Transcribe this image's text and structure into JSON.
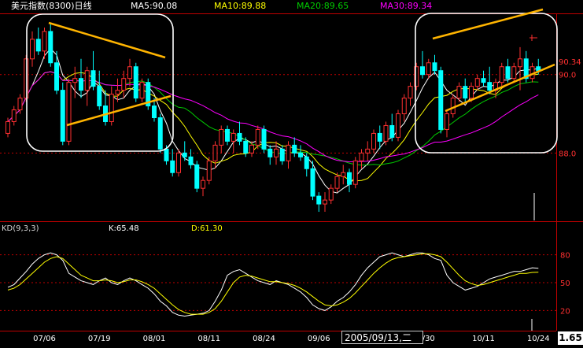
{
  "header": {
    "title": "美元指数(8300)日线",
    "ma5": "MA5:90.08",
    "ma10": "MA10:89.88",
    "ma20": "MA20:89.65",
    "ma30": "MA30:89.34"
  },
  "kd": {
    "label": "KD(9,3,3)",
    "k": "K:65.48",
    "d": "D:61.30"
  },
  "cursor": {
    "date_label": "2005/09/13,二",
    "price_label": "1.65"
  },
  "colors": {
    "up": "#ff3030",
    "down": "#00ffff",
    "ma5": "#ffffff",
    "ma10": "#ffff00",
    "ma20": "#00cc00",
    "ma30": "#ff00ff",
    "trend": "#ffb400",
    "grid": "#c00000"
  },
  "chart_data": [
    {
      "type": "candlestick",
      "title": "美元指数(8300)日线",
      "ylim": [
        86.3,
        91.5
      ],
      "y_ticks": [
        {
          "value": 90.34,
          "label": "90.34"
        },
        {
          "value": 90.0,
          "label": "90.0"
        },
        {
          "value": 88.0,
          "label": "88.0"
        }
      ],
      "x_ticks": [
        "07/06",
        "07/19",
        "08/01",
        "08/11",
        "08/24",
        "09/06",
        "/30",
        "10/11",
        "10/24"
      ],
      "x_tick_index": [
        6,
        15,
        24,
        33,
        42,
        51,
        69,
        78,
        87
      ],
      "ma_series": [
        {
          "name": "MA5",
          "window": 5
        },
        {
          "name": "MA10",
          "window": 10
        },
        {
          "name": "MA20",
          "window": 20
        },
        {
          "name": "MA30",
          "window": 30
        }
      ],
      "candles": [
        [
          88.5,
          88.9,
          88.4,
          88.8
        ],
        [
          88.8,
          89.2,
          88.7,
          89.1
        ],
        [
          89.1,
          89.5,
          89.0,
          89.4
        ],
        [
          89.4,
          90.5,
          89.3,
          90.4
        ],
        [
          90.4,
          91.1,
          90.2,
          90.9
        ],
        [
          90.9,
          91.2,
          90.5,
          90.6
        ],
        [
          90.6,
          91.2,
          90.4,
          91.1
        ],
        [
          91.1,
          91.3,
          90.2,
          90.3
        ],
        [
          90.3,
          90.6,
          89.5,
          89.6
        ],
        [
          89.6,
          89.8,
          88.2,
          88.3
        ],
        [
          88.3,
          89.9,
          88.2,
          89.8
        ],
        [
          89.8,
          90.2,
          89.4,
          89.9
        ],
        [
          89.9,
          90.4,
          89.4,
          89.6
        ],
        [
          89.6,
          90.2,
          89.2,
          90.1
        ],
        [
          90.1,
          90.6,
          89.6,
          89.7
        ],
        [
          89.7,
          90.1,
          89.1,
          89.2
        ],
        [
          89.2,
          89.6,
          88.7,
          88.8
        ],
        [
          88.8,
          89.7,
          88.7,
          89.5
        ],
        [
          89.5,
          89.9,
          89.3,
          89.6
        ],
        [
          89.6,
          90.1,
          89.4,
          89.9
        ],
        [
          89.9,
          90.4,
          89.7,
          90.2
        ],
        [
          90.2,
          90.3,
          89.3,
          89.4
        ],
        [
          89.4,
          89.9,
          89.3,
          89.8
        ],
        [
          89.8,
          89.9,
          89.1,
          89.2
        ],
        [
          89.2,
          89.4,
          88.8,
          88.9
        ],
        [
          88.9,
          89.0,
          88.0,
          88.1
        ],
        [
          88.1,
          88.2,
          87.7,
          87.8
        ],
        [
          87.8,
          88.1,
          87.4,
          87.5
        ],
        [
          87.5,
          88.1,
          87.4,
          88.0
        ],
        [
          88.0,
          88.3,
          87.8,
          87.9
        ],
        [
          87.9,
          88.1,
          87.6,
          87.7
        ],
        [
          87.7,
          87.8,
          87.0,
          87.1
        ],
        [
          87.1,
          87.4,
          86.9,
          87.3
        ],
        [
          87.3,
          87.9,
          87.2,
          87.8
        ],
        [
          87.8,
          88.3,
          87.6,
          88.2
        ],
        [
          88.2,
          88.7,
          88.0,
          88.6
        ],
        [
          88.6,
          88.7,
          88.2,
          88.3
        ],
        [
          88.3,
          88.6,
          88.0,
          88.5
        ],
        [
          88.5,
          88.8,
          88.2,
          88.3
        ],
        [
          88.3,
          88.4,
          87.9,
          88.0
        ],
        [
          88.0,
          88.3,
          87.9,
          88.2
        ],
        [
          88.2,
          88.7,
          88.1,
          88.6
        ],
        [
          88.6,
          88.7,
          88.0,
          88.1
        ],
        [
          88.1,
          88.2,
          87.7,
          87.9
        ],
        [
          87.9,
          88.3,
          87.7,
          88.1
        ],
        [
          88.1,
          88.2,
          87.7,
          87.8
        ],
        [
          87.8,
          88.3,
          87.6,
          88.2
        ],
        [
          88.2,
          88.4,
          87.9,
          88.0
        ],
        [
          88.0,
          88.2,
          87.8,
          87.9
        ],
        [
          87.9,
          88.0,
          87.4,
          87.6
        ],
        [
          87.6,
          87.8,
          86.8,
          86.9
        ],
        [
          86.9,
          87.0,
          86.5,
          86.7
        ],
        [
          86.7,
          87.0,
          86.5,
          86.8
        ],
        [
          86.8,
          87.2,
          86.7,
          87.1
        ],
        [
          87.1,
          87.5,
          87.0,
          87.4
        ],
        [
          87.4,
          87.7,
          87.2,
          87.5
        ],
        [
          87.5,
          87.6,
          87.0,
          87.2
        ],
        [
          87.2,
          87.9,
          87.1,
          87.8
        ],
        [
          87.8,
          88.1,
          87.6,
          88.0
        ],
        [
          88.0,
          88.3,
          87.8,
          88.1
        ],
        [
          88.1,
          88.6,
          88.0,
          88.5
        ],
        [
          88.5,
          88.7,
          88.1,
          88.3
        ],
        [
          88.3,
          88.8,
          88.2,
          88.7
        ],
        [
          88.7,
          89.0,
          88.3,
          88.4
        ],
        [
          88.4,
          89.1,
          88.3,
          89.0
        ],
        [
          89.0,
          89.5,
          88.8,
          89.4
        ],
        [
          89.4,
          89.8,
          89.2,
          89.7
        ],
        [
          89.7,
          90.3,
          89.6,
          90.2
        ],
        [
          90.2,
          90.6,
          89.9,
          90.0
        ],
        [
          90.0,
          90.4,
          89.9,
          90.3
        ],
        [
          90.3,
          90.5,
          90.0,
          90.1
        ],
        [
          90.1,
          90.2,
          88.5,
          88.6
        ],
        [
          88.6,
          89.1,
          88.4,
          89.0
        ],
        [
          89.0,
          89.5,
          88.9,
          89.4
        ],
        [
          89.4,
          89.8,
          89.3,
          89.7
        ],
        [
          89.7,
          89.9,
          89.3,
          89.4
        ],
        [
          89.4,
          89.8,
          89.3,
          89.7
        ],
        [
          89.7,
          90.0,
          89.6,
          89.9
        ],
        [
          89.9,
          90.1,
          89.7,
          89.8
        ],
        [
          89.8,
          90.2,
          89.5,
          89.6
        ],
        [
          89.6,
          89.9,
          89.4,
          89.8
        ],
        [
          89.8,
          90.3,
          89.7,
          90.2
        ],
        [
          90.2,
          90.4,
          89.8,
          89.9
        ],
        [
          89.9,
          90.3,
          89.8,
          90.2
        ],
        [
          90.2,
          90.7,
          89.6,
          90.4
        ],
        [
          90.4,
          90.6,
          89.8,
          89.9
        ],
        [
          89.9,
          90.3,
          89.8,
          90.2
        ],
        [
          90.2,
          90.4,
          90.0,
          90.1
        ]
      ]
    },
    {
      "type": "line",
      "title": "KD(9,3,3)",
      "ylim": [
        0,
        100
      ],
      "y_ticks": [
        20,
        50,
        80
      ],
      "series": [
        {
          "name": "K",
          "values": [
            45,
            48,
            55,
            62,
            70,
            76,
            80,
            82,
            80,
            74,
            60,
            56,
            52,
            50,
            48,
            52,
            55,
            50,
            48,
            52,
            55,
            52,
            48,
            44,
            38,
            30,
            25,
            18,
            15,
            14,
            15,
            16,
            17,
            20,
            30,
            42,
            58,
            62,
            64,
            60,
            56,
            52,
            50,
            48,
            52,
            50,
            48,
            44,
            40,
            34,
            26,
            22,
            20,
            24,
            30,
            34,
            40,
            48,
            58,
            66,
            72,
            78,
            80,
            82,
            80,
            78,
            80,
            82,
            82,
            80,
            76,
            74,
            58,
            50,
            46,
            42,
            44,
            46,
            50,
            54,
            56,
            58,
            60,
            62,
            62,
            64,
            66,
            65.48
          ]
        },
        {
          "name": "D",
          "values": [
            42,
            44,
            48,
            54,
            60,
            66,
            72,
            76,
            78,
            76,
            70,
            64,
            58,
            55,
            52,
            52,
            53,
            52,
            50,
            51,
            53,
            53,
            51,
            48,
            44,
            38,
            32,
            26,
            21,
            18,
            16,
            16,
            16,
            18,
            22,
            30,
            40,
            50,
            56,
            58,
            57,
            55,
            53,
            51,
            51,
            50,
            49,
            47,
            44,
            40,
            35,
            30,
            26,
            25,
            26,
            29,
            33,
            39,
            46,
            53,
            60,
            66,
            71,
            75,
            77,
            78,
            79,
            80,
            81,
            81,
            80,
            78,
            72,
            65,
            58,
            52,
            49,
            47,
            48,
            50,
            52,
            54,
            56,
            58,
            60,
            60,
            61,
            61.3
          ]
        }
      ]
    }
  ]
}
